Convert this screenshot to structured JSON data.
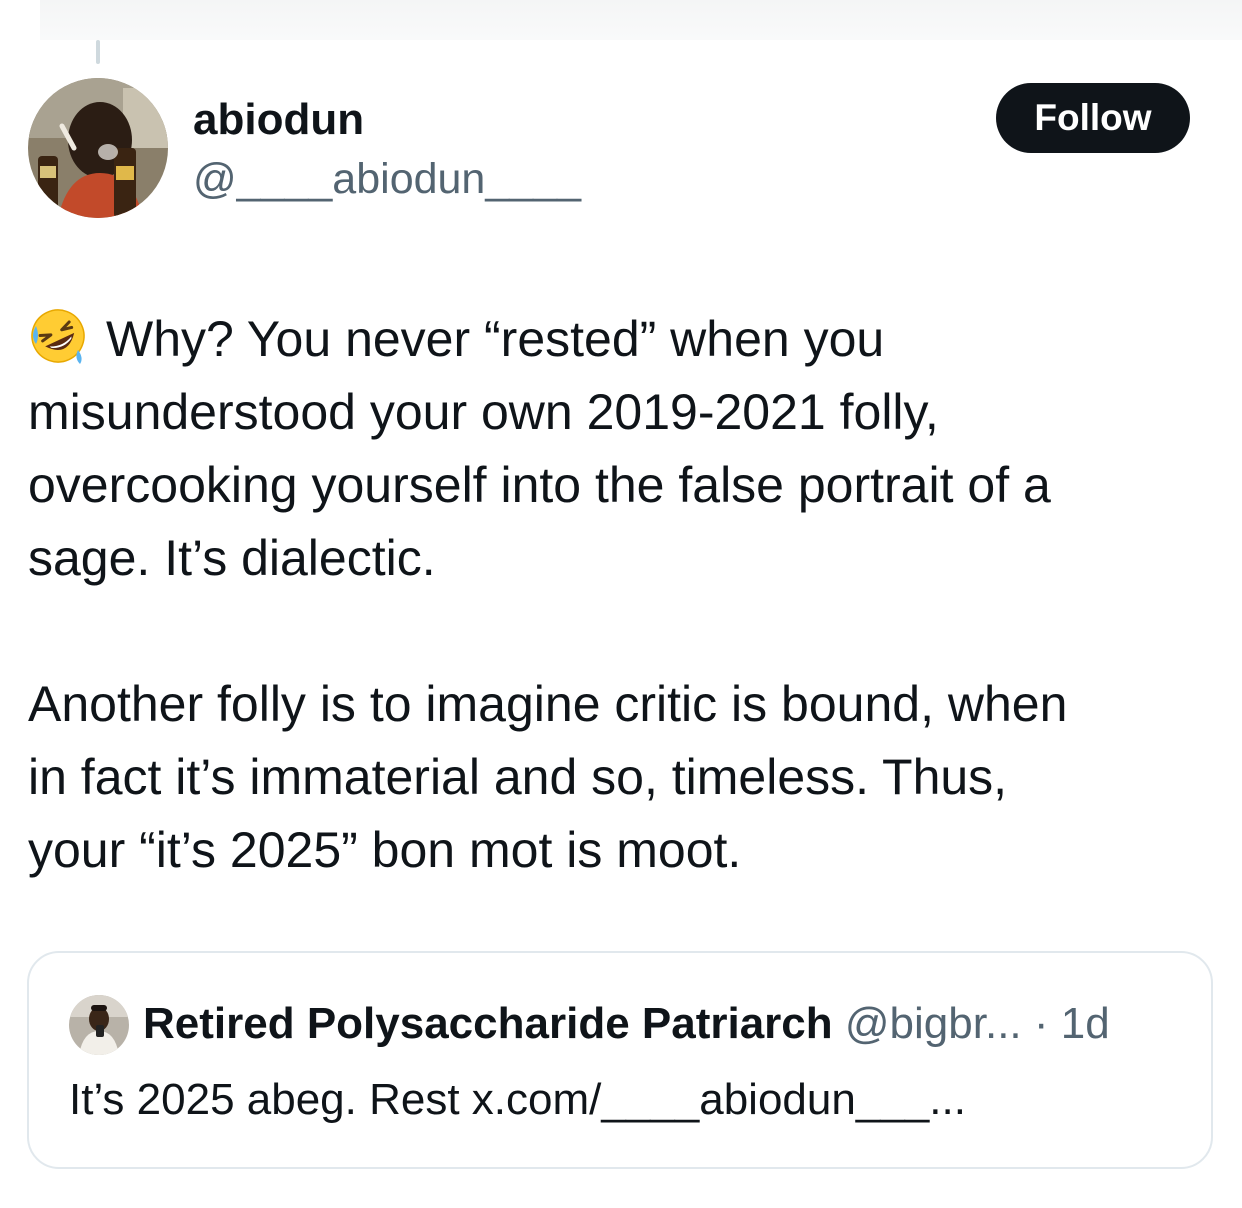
{
  "author": {
    "display_name": "abiodun",
    "handle": "@____abiodun____",
    "avatar_icon": "profile-photo"
  },
  "follow_button": {
    "label": "Follow"
  },
  "tweet": {
    "emoji_icon": "rolling-on-the-floor-laughing-emoji",
    "lines": [
      "Why? You never “rested” when you",
      "misunderstood your own 2019-2021 folly,",
      "overcooking yourself into the false portrait of a",
      "sage. It’s dialectic.",
      "Another folly is to imagine critic is bound, when",
      "in fact it’s immaterial and so, timeless. Thus,",
      "your “it’s 2025” bon mot is moot."
    ]
  },
  "quoted_tweet": {
    "display_name": "Retired Polysaccharide Patriarch",
    "handle": "@bigbr...",
    "separator": "·",
    "time": "1d",
    "text": "It’s 2025 abeg. Rest x.com/____abiodun___..."
  },
  "colors": {
    "text_primary": "#0f1419",
    "text_secondary": "#536471",
    "follow_bg": "#0f1419",
    "card_border": "#e1e8ed"
  }
}
